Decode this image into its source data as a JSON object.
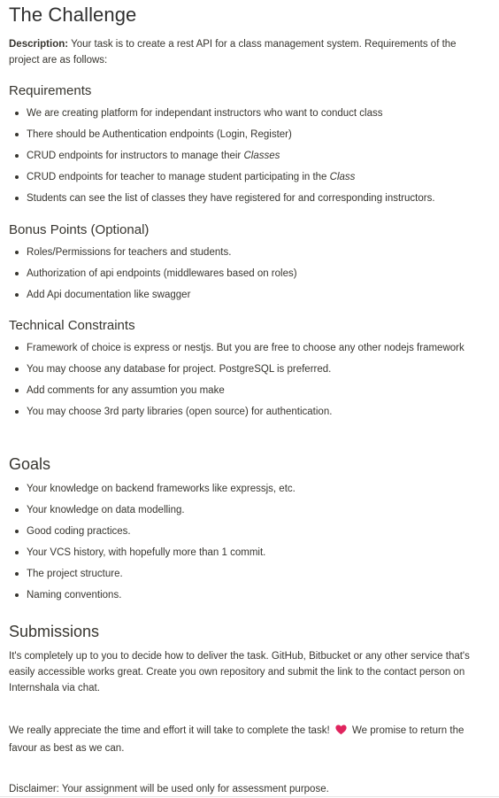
{
  "title": "The Challenge",
  "description": {
    "label": "Description:",
    "text": " Your task is to create a rest API for a class management system. Requirements of the project are as follows:"
  },
  "requirements": {
    "heading": "Requirements",
    "items": [
      {
        "text": "We are creating platform for independant instructors who want to conduct class",
        "em": ""
      },
      {
        "text": "There should be Authentication endpoints (Login, Register)",
        "em": ""
      },
      {
        "text": "CRUD endpoints for instructors to manage their ",
        "em": "Classes"
      },
      {
        "text": "CRUD endpoints for teacher to manage student participating in the ",
        "em": "Class"
      },
      {
        "text": "Students can see the list of classes they have registered for and corresponding instructors.",
        "em": ""
      }
    ]
  },
  "bonus": {
    "heading": "Bonus Points (Optional)",
    "items": [
      "Roles/Permissions for teachers and students.",
      "Authorization of api endpoints (middlewares based on roles)",
      "Add Api documentation like swagger"
    ]
  },
  "technical": {
    "heading": "Technical Constraints",
    "items": [
      "Framework of choice is express or nestjs. But you are free to choose any other nodejs framework",
      "You may choose any database for project. PostgreSQL is preferred.",
      "Add comments for any assumtion you make",
      "You may choose 3rd party libraries (open source) for authentication."
    ]
  },
  "goals": {
    "heading": "Goals",
    "items": [
      "Your knowledge on backend frameworks like expressjs, etc.",
      "Your knowledge on data modelling.",
      "Good coding practices.",
      "Your VCS history, with hopefully more than 1 commit.",
      "The project structure.",
      "Naming conventions."
    ]
  },
  "submissions": {
    "heading": "Submissions",
    "paragraph": "It's completely up to you to decide how to deliver the task. GitHub, Bitbucket or any other service that's easily accessible works great. Create you own repository and submit the link to the contact person on Internshala via chat.",
    "appreciation_before": "We really appreciate the time and effort it will take to complete the task!",
    "appreciation_after": "We promise to return the favour as best as we can.",
    "heart_icon": "red-heart-icon",
    "heart_color": "#e0245e",
    "disclaimer": "Disclaimer: Your assignment will be used only for assessment purpose."
  }
}
